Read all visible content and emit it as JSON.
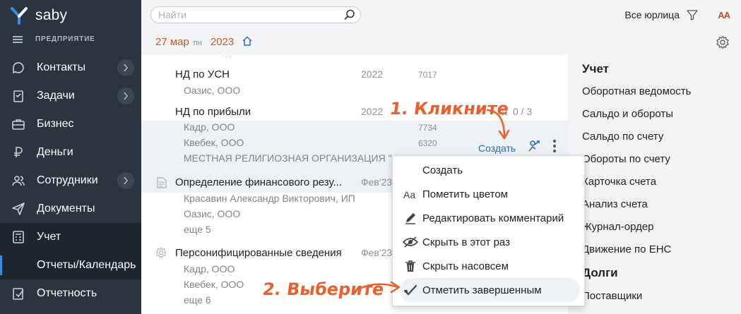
{
  "sidebar": {
    "brand": "saby",
    "org_label": "ПРЕДПРИЯТИЕ",
    "items": [
      {
        "label": "Контакты",
        "icon": "contacts-icon",
        "has_chevron": true
      },
      {
        "label": "Задачи",
        "icon": "tasks-icon",
        "has_chevron": true
      },
      {
        "label": "Бизнес",
        "icon": "briefcase-icon",
        "has_chevron": false
      },
      {
        "label": "Деньги",
        "icon": "money-icon",
        "has_chevron": false
      },
      {
        "label": "Сотрудники",
        "icon": "employees-icon",
        "has_chevron": true
      },
      {
        "label": "Документы",
        "icon": "documents-icon",
        "has_chevron": false
      },
      {
        "label": "Учет",
        "icon": "accounting-icon",
        "has_chevron": false
      },
      {
        "label": "Отчеты/Календарь",
        "icon": "",
        "has_chevron": false
      },
      {
        "label": "Отчетность",
        "icon": "reporting-icon",
        "has_chevron": false
      }
    ]
  },
  "header": {
    "search_placeholder": "Найти",
    "entities_label": "Все юрлица",
    "font_toggle": "AA",
    "date_day": "27 мар",
    "date_weekday": "пн",
    "date_year": "2023"
  },
  "list": {
    "orphan_text": "ЗД",
    "items": [
      {
        "title": "НД по УСН",
        "year": "2022",
        "code": "7017",
        "subs": [
          "Оазис, ООО"
        ]
      },
      {
        "title": "НД по прибыли",
        "year": "2022",
        "progress": "0 / 3",
        "subs": [
          "Кадр, ООО",
          "Квебек, ООО",
          "МЕСТНАЯ РЕЛИГИОЗНАЯ ОРГАНИЗАЦИЯ \"..."
        ],
        "sub_codes": [
          "7734",
          "6320"
        ]
      },
      {
        "title": "Определение финансового резу...",
        "year": "Фев'23",
        "subs": [
          "Красавин Александр Викторович, ИП",
          "Оазис, ООО",
          "еще 5"
        ]
      },
      {
        "title": "Персонифицированные сведения",
        "year": "Фев'23",
        "subs": [
          "Кадр, ООО",
          "Квебек, ООО",
          "еще 6"
        ]
      }
    ],
    "create_link": "Создать"
  },
  "right_panel": {
    "section1": "Учет",
    "links1": [
      "Оборотная ведомость",
      "Сальдо и обороты",
      "Сальдо по счету",
      "Обороты по счету",
      "Карточка счета",
      "Анализ счета",
      "Журнал-ордер",
      "Движение по ЕНС"
    ],
    "section2": "Долги",
    "links2": [
      "Поставщики"
    ]
  },
  "menu": {
    "items": [
      {
        "label": "Создать",
        "icon": ""
      },
      {
        "label": "Пометить цветом",
        "icon": "text-color-icon"
      },
      {
        "label": "Редактировать комментарий",
        "icon": "pencil-icon"
      },
      {
        "label": "Скрыть в этот раз",
        "icon": "eye-off-icon"
      },
      {
        "label": "Скрыть насовсем",
        "icon": "trash-icon"
      },
      {
        "label": "Отметить завершенным",
        "icon": "checkmark-icon"
      }
    ]
  },
  "annotations": {
    "step1": "1. Кликните",
    "step2": "2. Выберите"
  },
  "colors": {
    "sidebar_bg": "#2a3540",
    "accent_orange": "#e8612c",
    "date_red": "#d0542c",
    "link_blue": "#2a6fbd"
  }
}
